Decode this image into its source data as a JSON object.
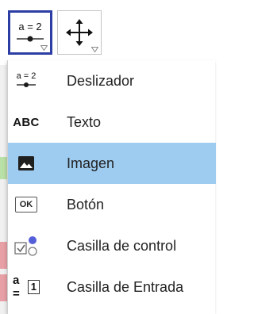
{
  "toolbar": {
    "buttons": [
      {
        "name": "slider-tool",
        "icon_text": "a = 2",
        "active": true
      },
      {
        "name": "move-graphics-tool",
        "active": false
      }
    ]
  },
  "menu": {
    "items": [
      {
        "label": "Deslizador",
        "icon": "slider-icon",
        "icon_text": "a = 2",
        "selected": false
      },
      {
        "label": "Texto",
        "icon": "text-icon",
        "icon_text": "ABC",
        "selected": false
      },
      {
        "label": "Imagen",
        "icon": "image-icon",
        "selected": true
      },
      {
        "label": "Botón",
        "icon": "button-icon",
        "icon_text": "OK",
        "selected": false
      },
      {
        "label": "Casilla de control",
        "icon": "checkbox-icon",
        "selected": false
      },
      {
        "label": "Casilla de Entrada",
        "icon": "input-box-icon",
        "icon_text": "a =",
        "icon_value": "1",
        "selected": false
      }
    ]
  },
  "colors": {
    "accent_border": "#2c3ea3",
    "selected_bg": "#9ecbf0",
    "slider_point": "#1a1a1a",
    "checkbox_check": "#5560d8"
  }
}
